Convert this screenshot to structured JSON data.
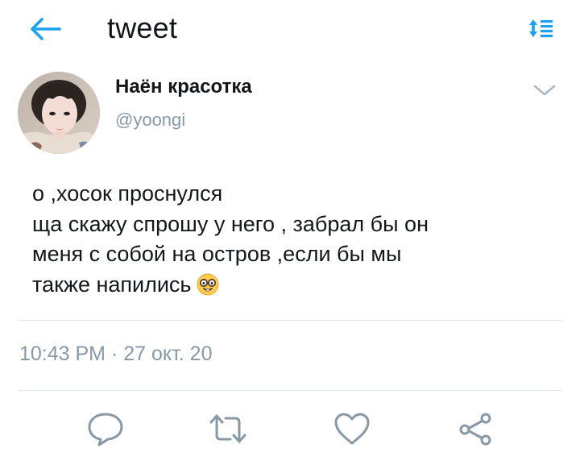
{
  "header": {
    "title": "tweet",
    "back_icon": "arrow-left-icon",
    "sort_icon": "sort-arrows-icon"
  },
  "author": {
    "name": "Наён красотка",
    "handle": "@yoongi",
    "avatar_icon": "profile-photo"
  },
  "tweet": {
    "lines": [
      "о ,хосок проснулся",
      "ща скажу спрошу у него , забрал бы он",
      "меня с собой на остров ,если бы мы",
      "также напились"
    ],
    "emoji_icon": "nerd-face-emoji",
    "timestamp": "10:43 PM · 27 окт. 20"
  },
  "actions": {
    "reply_icon": "reply-icon",
    "retweet_icon": "retweet-icon",
    "like_icon": "heart-icon",
    "share_icon": "share-icon"
  },
  "colors": {
    "accent": "#1da1f2",
    "secondary_text": "#8899a6",
    "primary_text": "#14171a",
    "divider": "#e1e8ed"
  }
}
